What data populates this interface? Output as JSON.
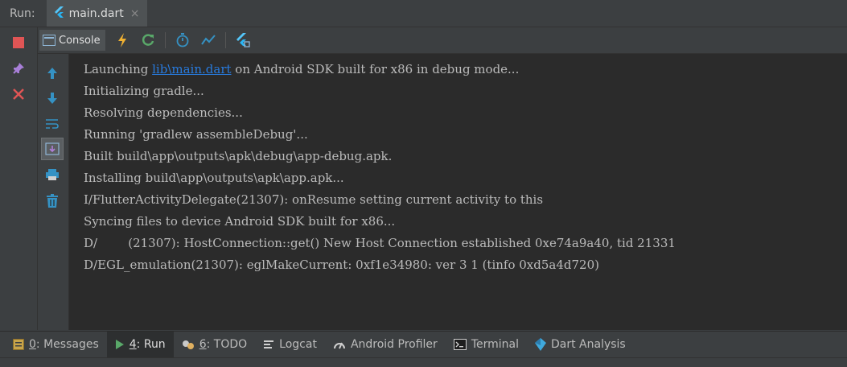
{
  "titlebar": {
    "run_label": "Run:",
    "file_tab": "main.dart",
    "close_glyph": "×"
  },
  "toolbar": {
    "console_label": "Console"
  },
  "console": {
    "lines": [
      {
        "pre": "Launching ",
        "link": "lib\\main.dart",
        "post": " on Android SDK built for x86 in debug mode..."
      },
      "Initializing gradle...",
      "Resolving dependencies...",
      "Running 'gradlew assembleDebug'...",
      "Built build\\app\\outputs\\apk\\debug\\app-debug.apk.",
      "Installing build\\app\\outputs\\apk\\app.apk...",
      "I/FlutterActivityDelegate(21307): onResume setting current activity to this",
      "Syncing files to device Android SDK built for x86...",
      "D/        (21307): HostConnection::get() New Host Connection established 0xe74a9a40, tid 21331",
      "D/EGL_emulation(21307): eglMakeCurrent: 0xf1e34980: ver 3 1 (tinfo 0xd5a4d720)"
    ]
  },
  "bottom_tabs": [
    {
      "num": "0",
      "label": ": Messages",
      "icon": "messages-icon"
    },
    {
      "num": "4",
      "label": ": Run",
      "icon": "run-icon"
    },
    {
      "num": "6",
      "label": ": TODO",
      "icon": "todo-icon"
    },
    {
      "num": "",
      "label": "Logcat",
      "icon": "logcat-icon"
    },
    {
      "num": "",
      "label": "Android Profiler",
      "icon": "profiler-icon"
    },
    {
      "num": "",
      "label": "Terminal",
      "icon": "terminal-icon"
    },
    {
      "num": "",
      "label": "Dart Analysis",
      "icon": "dart-analysis-icon"
    }
  ],
  "colors": {
    "background": "#2b2b2b",
    "panel": "#3c3f41",
    "link": "#287bde",
    "stop_red": "#e05555",
    "run_green": "#59a869",
    "accent_blue": "#3592c4"
  }
}
